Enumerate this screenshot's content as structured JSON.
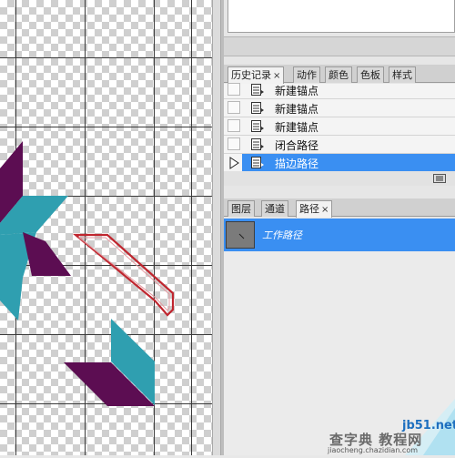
{
  "history_panel": {
    "tabs": [
      {
        "label": "历史记录",
        "close": "×"
      },
      {
        "label": "动作"
      },
      {
        "label": "颜色"
      },
      {
        "label": "色板"
      },
      {
        "label": "样式"
      }
    ],
    "items": [
      {
        "label": "新建锚点",
        "selected": false
      },
      {
        "label": "新建锚点",
        "selected": false
      },
      {
        "label": "新建锚点",
        "selected": false
      },
      {
        "label": "闭合路径",
        "selected": false
      },
      {
        "label": "描边路径",
        "selected": true
      }
    ]
  },
  "paths_panel": {
    "tabs": [
      {
        "label": "图层"
      },
      {
        "label": "通道"
      },
      {
        "label": "路径",
        "close": "×"
      }
    ],
    "items": [
      {
        "label": "工作路径",
        "selected": true
      }
    ]
  },
  "watermark": {
    "line1": "jb51.net",
    "line2": "查字典 教程网",
    "line3": "jiaocheng.chazidian.com"
  },
  "colors": {
    "purple": "#5c0d52",
    "teal": "#2f9fb0",
    "stroke_red": "#c0262f",
    "selection_blue": "#3a8ff2"
  }
}
